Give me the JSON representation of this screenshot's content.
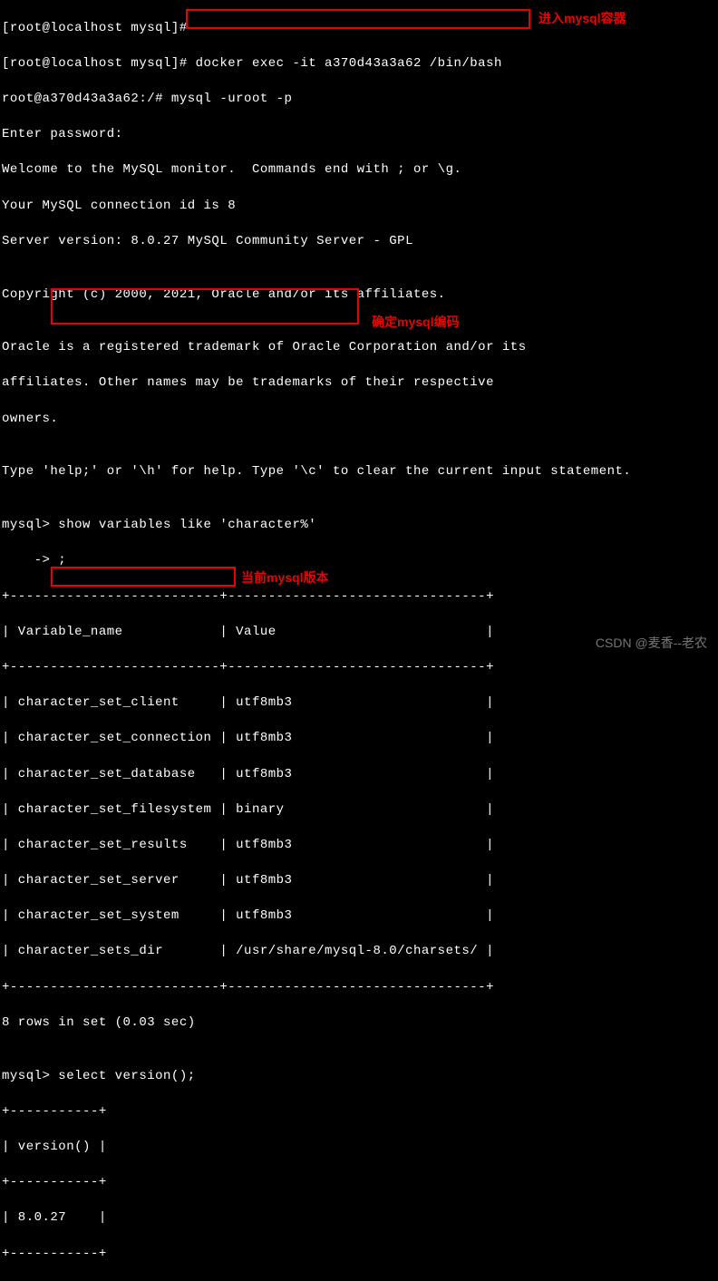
{
  "lines": {
    "l0": "[root@localhost mysql]#",
    "l1": "[root@localhost mysql]# docker exec -it a370d43a3a62 /bin/bash",
    "l2": "root@a370d43a3a62:/# mysql -uroot -p",
    "l3": "Enter password:",
    "l4": "Welcome to the MySQL monitor.  Commands end with ; or \\g.",
    "l5": "Your MySQL connection id is 8",
    "l6": "Server version: 8.0.27 MySQL Community Server - GPL",
    "l7": "",
    "l8": "Copyright (c) 2000, 2021, Oracle and/or its affiliates.",
    "l9": "",
    "l10": "Oracle is a registered trademark of Oracle Corporation and/or its",
    "l11": "affiliates. Other names may be trademarks of their respective",
    "l12": "owners.",
    "l13": "",
    "l14": "Type 'help;' or '\\h' for help. Type '\\c' to clear the current input statement.",
    "l15": "",
    "l16": "mysql> show variables like 'character%'",
    "l17": "    -> ;",
    "l18": "+--------------------------+--------------------------------+",
    "l19": "| Variable_name            | Value                          |",
    "l20": "+--------------------------+--------------------------------+",
    "l21": "| character_set_client     | utf8mb3                        |",
    "l22": "| character_set_connection | utf8mb3                        |",
    "l23": "| character_set_database   | utf8mb3                        |",
    "l24": "| character_set_filesystem | binary                         |",
    "l25": "| character_set_results    | utf8mb3                        |",
    "l26": "| character_set_server     | utf8mb3                        |",
    "l27": "| character_set_system     | utf8mb3                        |",
    "l28": "| character_sets_dir       | /usr/share/mysql-8.0/charsets/ |",
    "l29": "+--------------------------+--------------------------------+",
    "l30": "8 rows in set (0.03 sec)",
    "l31": "",
    "l32": "mysql> select version();",
    "l33": "+-----------+",
    "l34": "| version() |",
    "l35": "+-----------+",
    "l36": "| 8.0.27    |",
    "l37": "+-----------+"
  },
  "annotations": {
    "ann1": "进入mysql容器",
    "ann2": "确定mysql编码",
    "ann3": "当前mysql版本"
  },
  "watermark": "CSDN @麦香--老农"
}
